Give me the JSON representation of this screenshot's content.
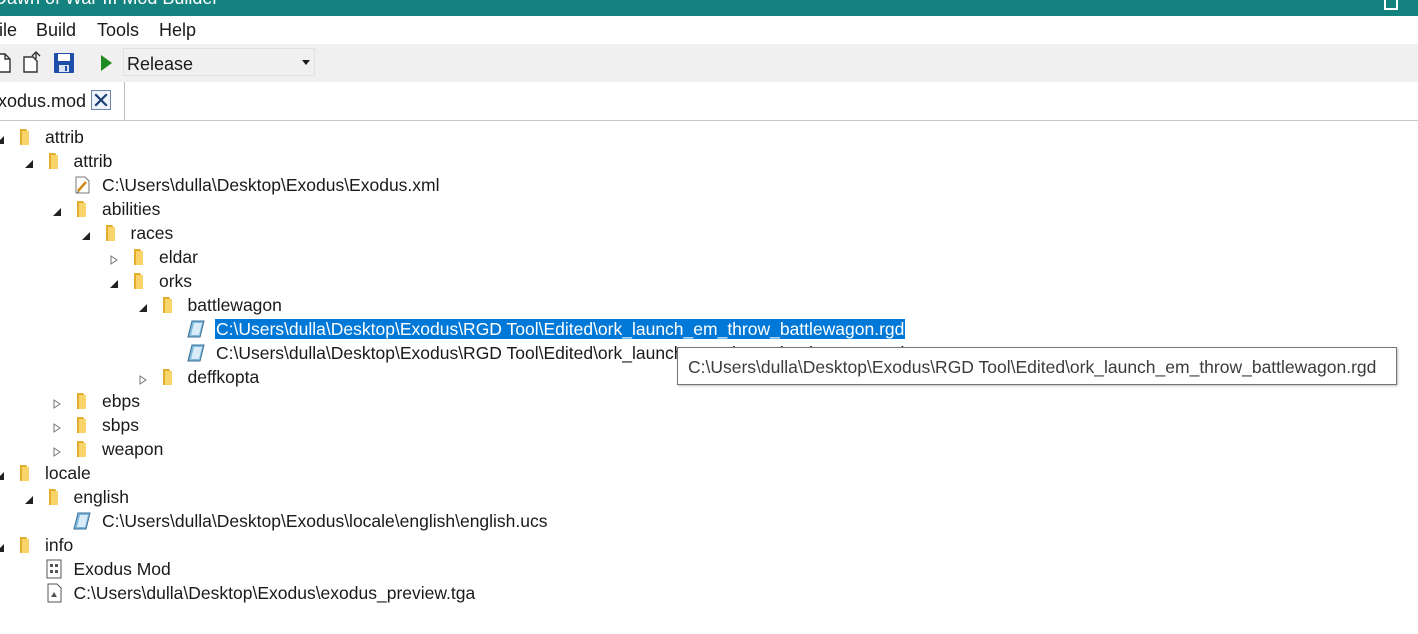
{
  "window": {
    "title": "Dawn of War III Mod Builder"
  },
  "menu": {
    "items": [
      "ile",
      "Build",
      "Tools",
      "Help"
    ]
  },
  "toolbar": {
    "buttons": [
      "new-file-icon",
      "open-file-icon",
      "save-icon",
      "run-icon"
    ],
    "configuration": "Release",
    "colors": {
      "run": "#1f8a1f",
      "save": "#1f4ea8"
    }
  },
  "tabs": [
    {
      "label": "xodus.mod",
      "close_icon": "close-icon"
    }
  ],
  "tree": [
    {
      "label": "attrib",
      "icon": "folder",
      "expander": "expanded"
    },
    {
      "label": "attrib",
      "icon": "folder",
      "expander": "expanded"
    },
    {
      "label": "C:\\Users\\dulla\\Desktop\\Exodus\\Exodus.xml",
      "icon": "xml-file",
      "expander": "none"
    },
    {
      "label": "abilities",
      "icon": "folder",
      "expander": "expanded"
    },
    {
      "label": "races",
      "icon": "folder",
      "expander": "expanded"
    },
    {
      "label": "eldar",
      "icon": "folder",
      "expander": "collapsed"
    },
    {
      "label": "orks",
      "icon": "folder",
      "expander": "expanded"
    },
    {
      "label": "battlewagon",
      "icon": "folder",
      "expander": "expanded"
    },
    {
      "label": "C:\\Users\\dulla\\Desktop\\Exodus\\RGD Tool\\Edited\\ork_launch_em_throw_battlewagon.rgd",
      "icon": "rgd-file",
      "expander": "none",
      "selected": true
    },
    {
      "label": "C:\\Users\\dulla\\Desktop\\Exodus\\RGD Tool\\Edited\\ork_launch_em_throw_battlewagon.rgd",
      "icon": "rgd-file",
      "expander": "none"
    },
    {
      "label": "deffkopta",
      "icon": "folder",
      "expander": "collapsed"
    },
    {
      "label": "ebps",
      "icon": "folder",
      "expander": "collapsed"
    },
    {
      "label": "sbps",
      "icon": "folder",
      "expander": "collapsed"
    },
    {
      "label": "weapon",
      "icon": "folder",
      "expander": "collapsed"
    },
    {
      "label": "locale",
      "icon": "folder",
      "expander": "expanded"
    },
    {
      "label": "english",
      "icon": "folder",
      "expander": "expanded"
    },
    {
      "label": "C:\\Users\\dulla\\Desktop\\Exodus\\locale\\english\\english.ucs",
      "icon": "ucs-file",
      "expander": "none"
    },
    {
      "label": "info",
      "icon": "folder",
      "expander": "expanded"
    },
    {
      "label": "Exodus Mod",
      "icon": "info-file",
      "expander": "none"
    },
    {
      "label": "C:\\Users\\dulla\\Desktop\\Exodus\\exodus_preview.tga",
      "icon": "image-file",
      "expander": "none"
    }
  ],
  "tooltip": {
    "text": "C:\\Users\\dulla\\Desktop\\Exodus\\RGD Tool\\Edited\\ork_launch_em_throw_battlewagon.rgd"
  },
  "colors": {
    "titlebar": "#14837f",
    "selection": "#0078d7",
    "folder": "#f4c542",
    "toolbar": "#f0f0f0"
  }
}
